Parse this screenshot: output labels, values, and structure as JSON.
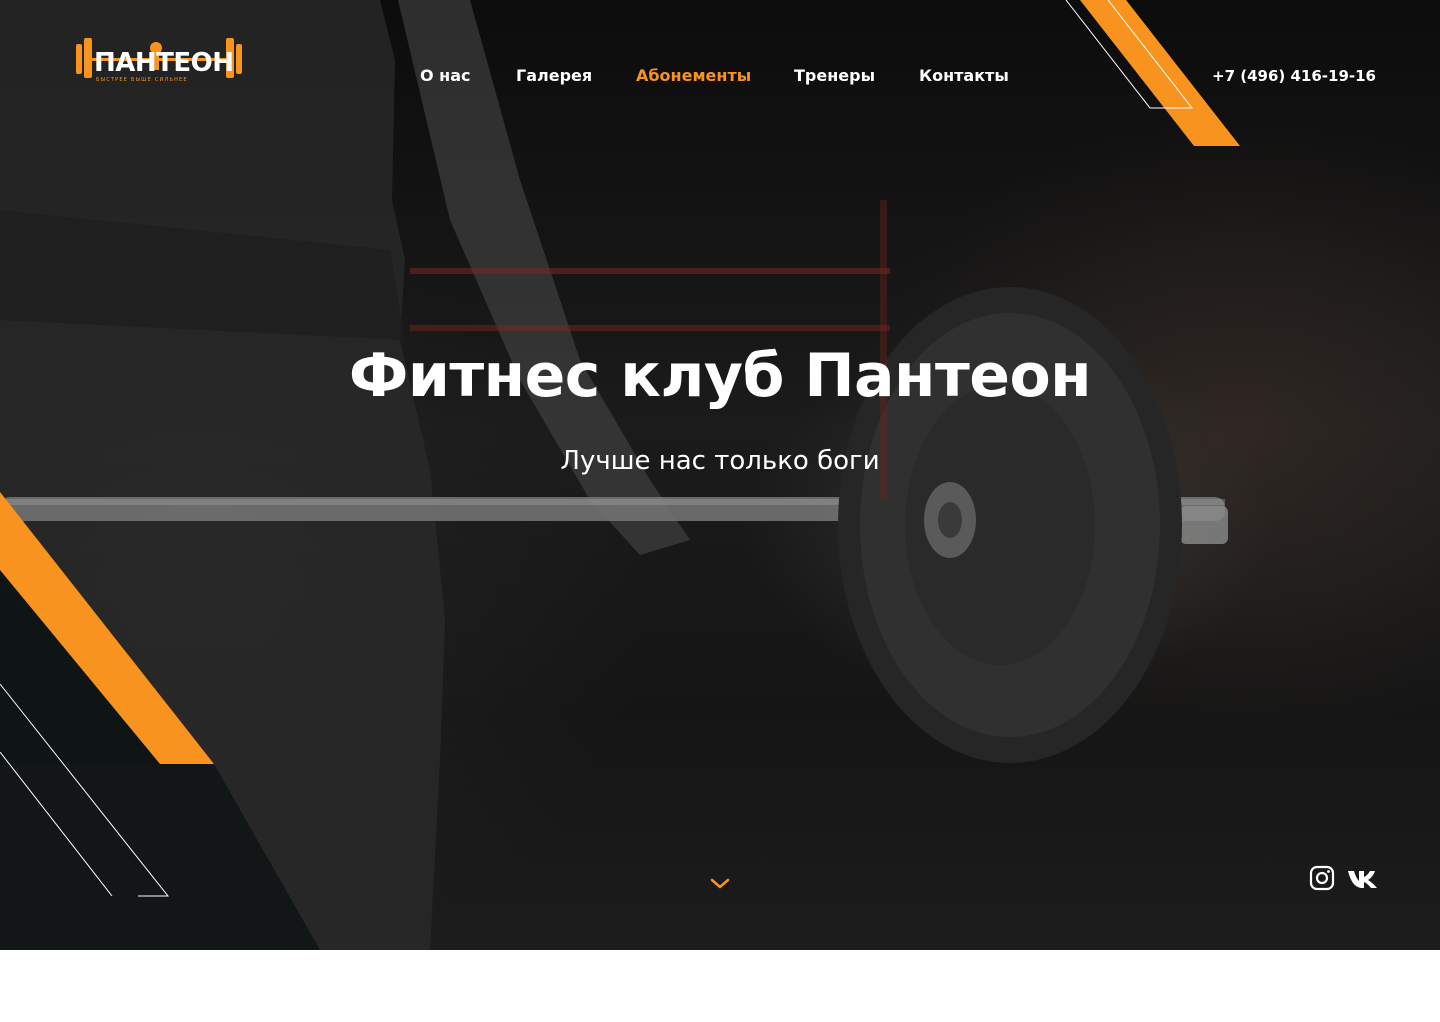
{
  "brand": {
    "logo_text": "ПАНТЕОН",
    "tagline": "БЫСТРЕЕ ВЫШЕ СИЛЬНЕЕ",
    "accent_color": "#f7931e"
  },
  "nav": {
    "items": [
      {
        "label": "О нас",
        "active": false
      },
      {
        "label": "Галерея",
        "active": false
      },
      {
        "label": "Абонементы",
        "active": true
      },
      {
        "label": "Тренеры",
        "active": false
      },
      {
        "label": "Контакты",
        "active": false
      }
    ]
  },
  "header": {
    "phone": "+7 (496) 416-19-16"
  },
  "hero": {
    "title": "Фитнес клуб Пантеон",
    "subtitle": "Лучше нас только боги"
  },
  "icons": {
    "scroll": "chevron-down-icon",
    "instagram": "instagram-icon",
    "vk": "vk-icon"
  }
}
